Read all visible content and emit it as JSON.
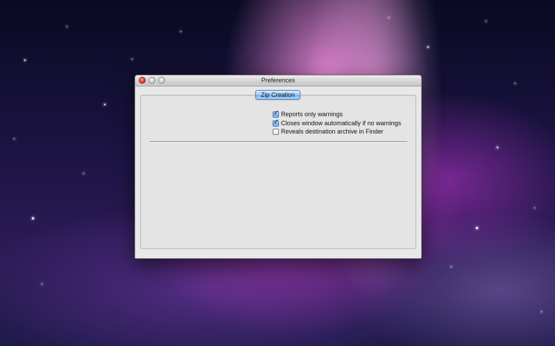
{
  "window": {
    "title": "Preferences"
  },
  "titlebar_buttons": {
    "close_icon": "close-icon",
    "minimize_icon": "minimize-icon",
    "zoom_icon": "zoom-icon"
  },
  "tabs": [
    {
      "label": "Zip Creation",
      "selected": true
    }
  ],
  "options": [
    {
      "label": "Reports only warnings",
      "checked": true
    },
    {
      "label": "Closes window automatically if no warnings",
      "checked": true
    },
    {
      "label": "Reveals destination archive in Finder",
      "checked": false
    }
  ],
  "colors": {
    "close_button": "#e1443a",
    "tab_accent": "#76b3ee",
    "window_background": "#e8e8e8"
  }
}
